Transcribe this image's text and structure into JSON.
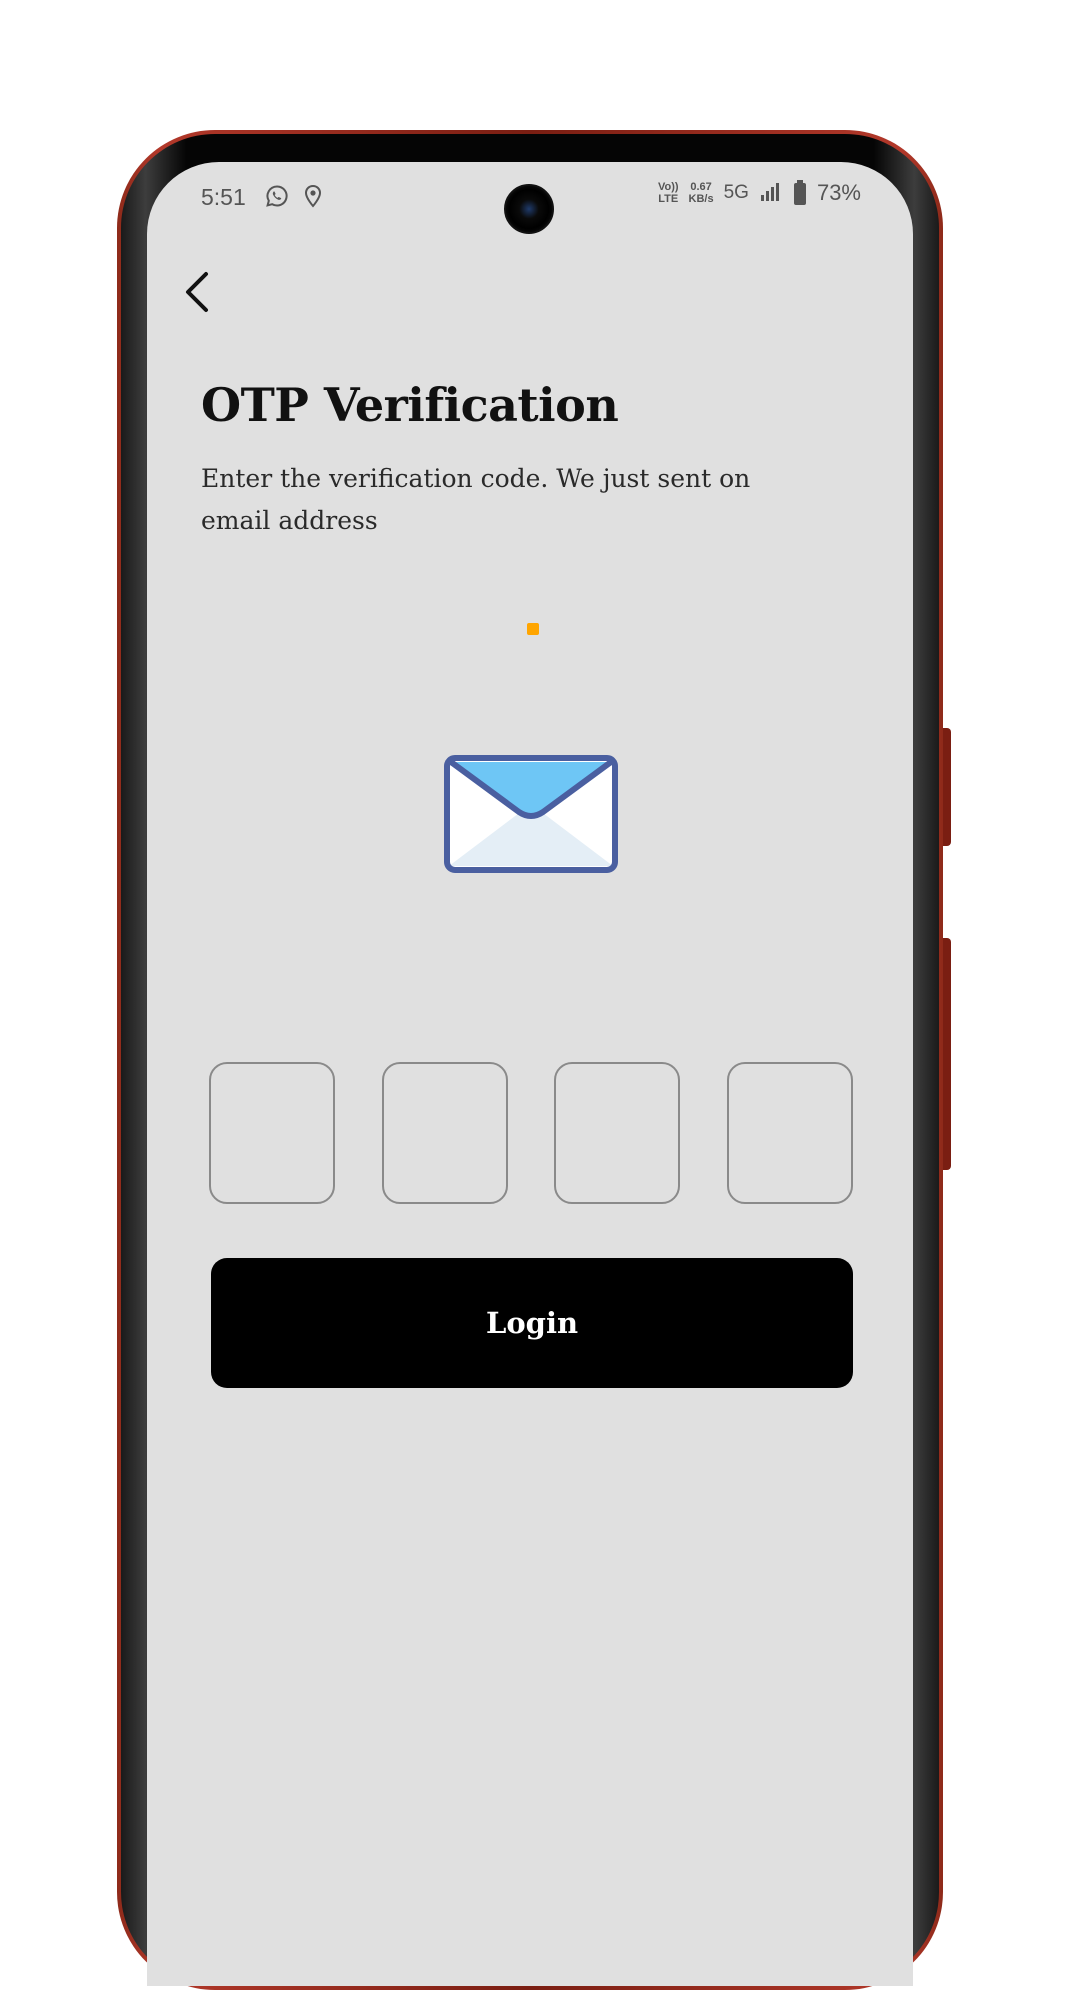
{
  "status_bar": {
    "time": "5:51",
    "left_icons": [
      "whatsapp-icon",
      "location-pin-icon"
    ],
    "network_line1": "Vo))",
    "network_line2": "LTE",
    "speed_value": "0.67",
    "speed_unit": "KB/s",
    "network_type": "5G",
    "battery": "73%"
  },
  "header": {
    "back_icon": "chevron-left-icon",
    "title": "OTP Verification",
    "subtitle": "Enter the verification code. We just sent on email address"
  },
  "illustration": {
    "icon": "envelope-icon",
    "loader_color": "#ffa500"
  },
  "otp": {
    "digits": [
      "",
      "",
      "",
      ""
    ]
  },
  "actions": {
    "login_label": "Login"
  },
  "colors": {
    "screen_background": "#e0e0e0",
    "button_background": "#000000",
    "button_text": "#ffffff",
    "envelope_flap": "#6ec6f5",
    "envelope_outline": "#4a5fa0"
  }
}
